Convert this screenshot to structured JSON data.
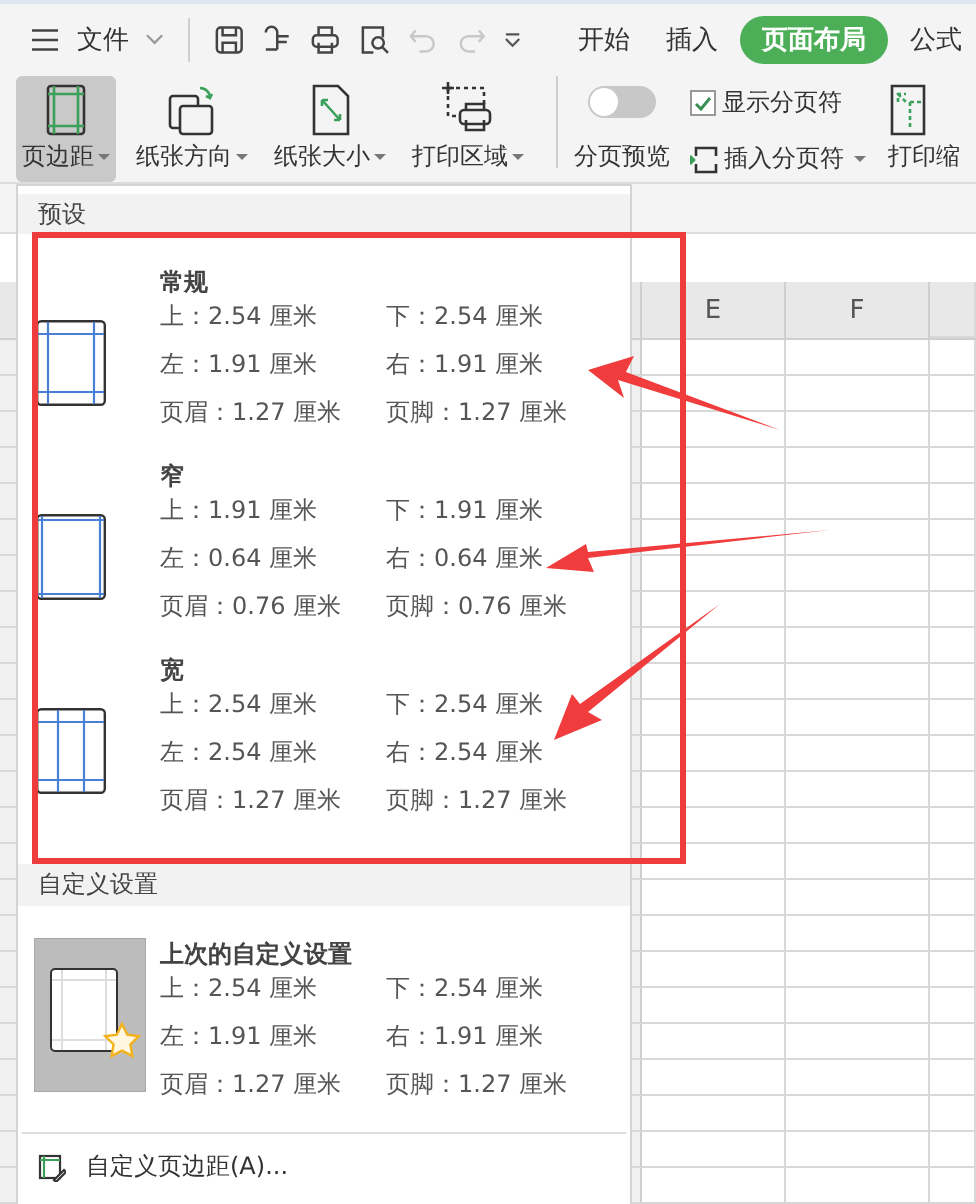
{
  "menu_bar": {
    "file_menu": "文件",
    "quick_access": [
      {
        "kind": "save",
        "disabled": false
      },
      {
        "kind": "painter",
        "disabled": false
      },
      {
        "kind": "print",
        "disabled": false
      },
      {
        "kind": "preview",
        "disabled": false
      },
      {
        "kind": "undo",
        "disabled": true
      },
      {
        "kind": "redo",
        "disabled": true
      }
    ],
    "tabs": [
      {
        "label": "开始",
        "selected": false
      },
      {
        "label": "插入",
        "selected": false
      },
      {
        "label": "页面布局",
        "selected": true
      },
      {
        "label": "公式",
        "selected": false
      }
    ]
  },
  "ribbon": {
    "buttons": [
      {
        "kind": "margins",
        "label": "页边距",
        "selected": true
      },
      {
        "kind": "orientation",
        "label": "纸张方向",
        "selected": false
      },
      {
        "kind": "size",
        "label": "纸张大小",
        "selected": false
      },
      {
        "kind": "print_area",
        "label": "打印区域",
        "selected": false
      }
    ],
    "page_break_preview": {
      "label": "分页预览",
      "on": false
    },
    "show_page_breaks": {
      "label": "显示分页符",
      "checked": true
    },
    "insert_page_break": {
      "label": "插入分页符"
    },
    "print_scale": {
      "label": "打印缩"
    }
  },
  "margins_menu": {
    "preset_header": "预设",
    "presets": [
      {
        "kind": "normal",
        "name": "常规",
        "values": [
          "上：2.54 厘米",
          "下：2.54 厘米",
          "左：1.91 厘米",
          "右：1.91 厘米",
          "页眉：1.27 厘米",
          "页脚：1.27 厘米"
        ]
      },
      {
        "kind": "narrow",
        "name": "窄",
        "values": [
          "上：1.91 厘米",
          "下：1.91 厘米",
          "左：0.64 厘米",
          "右：0.64 厘米",
          "页眉：0.76 厘米",
          "页脚：0.76 厘米"
        ]
      },
      {
        "kind": "wide",
        "name": "宽",
        "values": [
          "上：2.54 厘米",
          "下：2.54 厘米",
          "左：2.54 厘米",
          "右：2.54 厘米",
          "页眉：1.27 厘米",
          "页脚：1.27 厘米"
        ]
      }
    ],
    "custom_header": "自定义设置",
    "last_custom": {
      "name": "上次的自定义设置",
      "values": [
        "上：2.54 厘米",
        "下：2.54 厘米",
        "左：1.91 厘米",
        "右：1.91 厘米",
        "页眉：1.27 厘米",
        "页脚：1.27 厘米"
      ]
    },
    "custom_link": "自定义页边距(A)..."
  },
  "sheet": {
    "columns": [
      "E",
      "F"
    ]
  }
}
